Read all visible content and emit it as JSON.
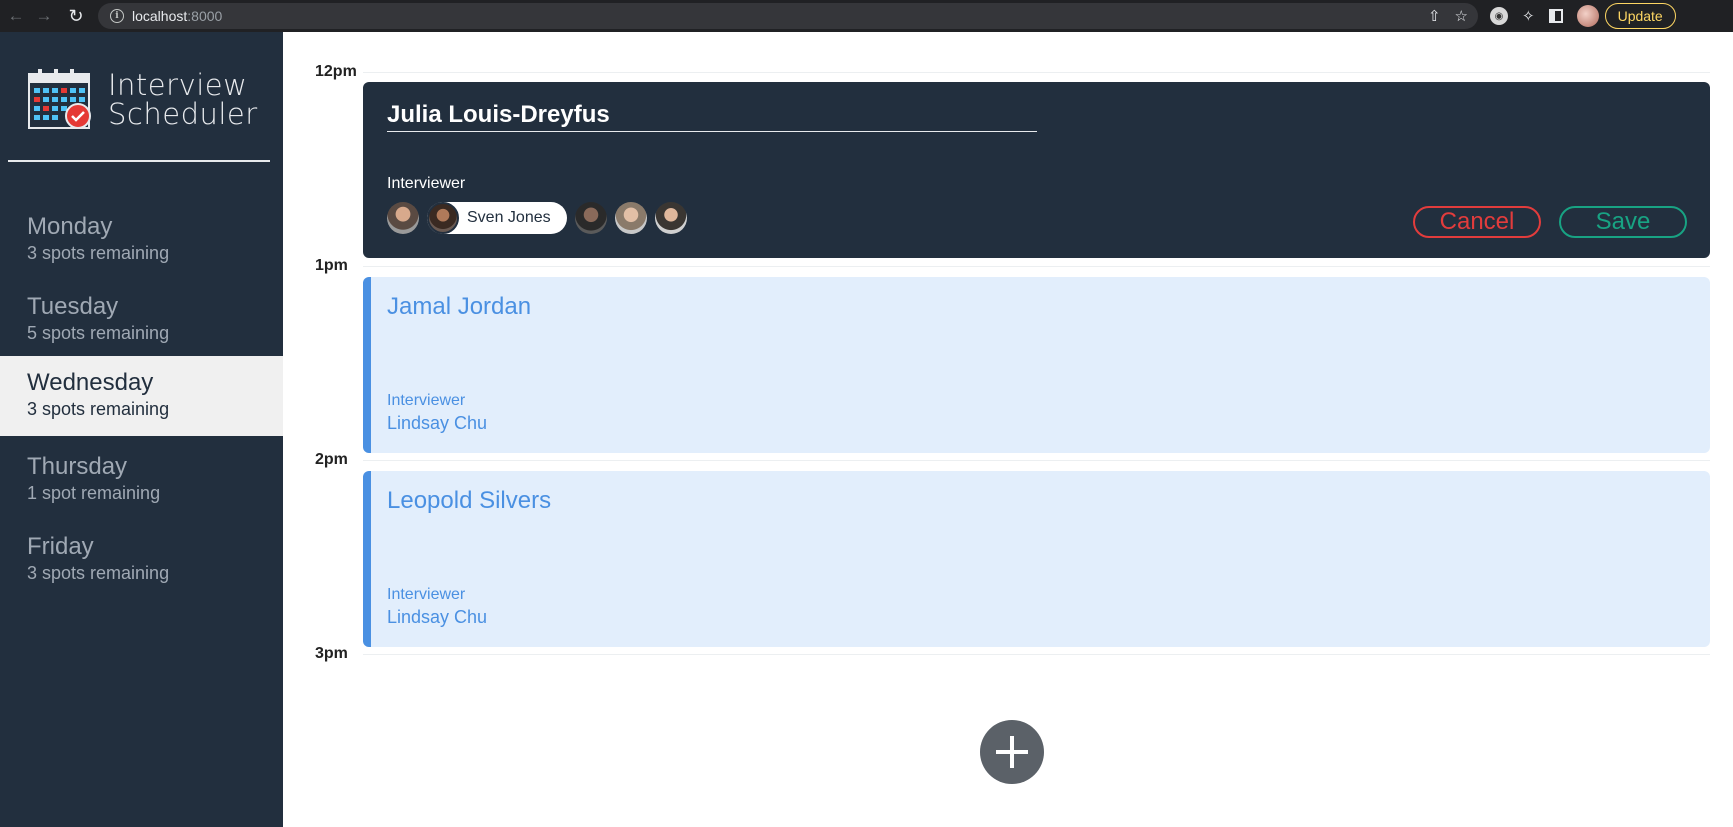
{
  "browser": {
    "url_host": "localhost",
    "url_port": ":8000",
    "update_label": "Update"
  },
  "sidebar": {
    "logo_line1": "Interview",
    "logo_line2": "Scheduler",
    "days": [
      {
        "name": "Monday",
        "spots": "3 spots remaining",
        "selected": false
      },
      {
        "name": "Tuesday",
        "spots": "5 spots remaining",
        "selected": false
      },
      {
        "name": "Wednesday",
        "spots": "3 spots remaining",
        "selected": true
      },
      {
        "name": "Thursday",
        "spots": "1 spot remaining",
        "selected": false
      },
      {
        "name": "Friday",
        "spots": "3 spots remaining",
        "selected": false
      }
    ]
  },
  "schedule": {
    "times": [
      "12pm",
      "1pm",
      "2pm",
      "3pm"
    ],
    "form": {
      "student_name": "Julia Louis-Dreyfus",
      "interviewer_label": "Interviewer",
      "selected_interviewer": "Sven Jones",
      "cancel_label": "Cancel",
      "save_label": "Save"
    },
    "appointments": [
      {
        "student": "Jamal Jordan",
        "interviewer_label": "Interviewer",
        "interviewer": "Lindsay Chu"
      },
      {
        "student": "Leopold Silvers",
        "interviewer_label": "Interviewer",
        "interviewer": "Lindsay Chu"
      }
    ]
  },
  "colors": {
    "sidebar_bg": "#222f3e",
    "selected_day_bg": "#f0f0f0",
    "appointment_accent": "#4a90e2",
    "cancel": "#e23c3c",
    "save": "#18a383"
  }
}
